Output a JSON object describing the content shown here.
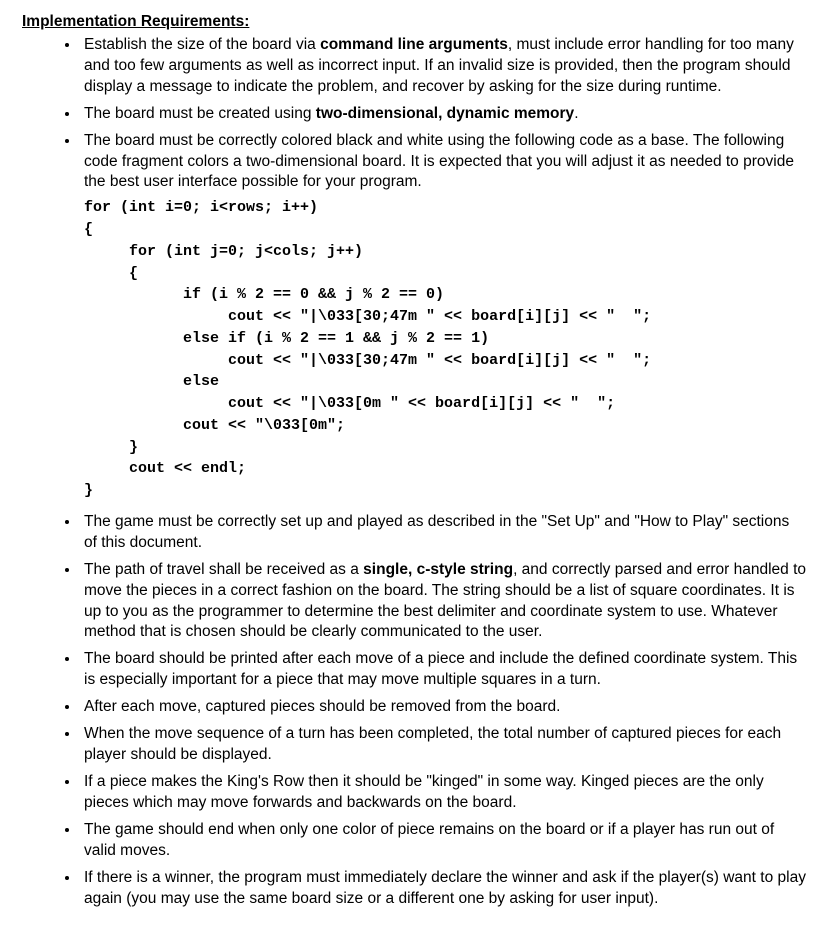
{
  "heading": "Implementation Requirements:",
  "bullets": {
    "b1a": "Establish the size of the board via ",
    "b1b": "command line arguments",
    "b1c": ", must include error handling for too many and too few arguments as well as incorrect input. If an invalid size is provided, then the program should display a message to indicate the problem, and recover by asking for the size during runtime.",
    "b2a": "The board must be created using ",
    "b2b": "two-dimensional, dynamic memory",
    "b2c": ".",
    "b3": "The board must be correctly colored black and white using the following code as a base. The following code fragment colors a two-dimensional board. It is expected that you will adjust it as needed to provide the best user interface possible for your program.",
    "b4": "The game must be correctly set up and played as described in the \"Set Up\" and \"How to Play\" sections of this document.",
    "b5a": "The path of travel shall be received as a ",
    "b5b": "single, c-style string",
    "b5c": ", and correctly parsed and error handled to move the pieces in a correct fashion on the board. The string should be a list of square coordinates. It is up to you as the programmer to determine the best delimiter and coordinate system to use. Whatever method that is chosen should be clearly communicated to the user.",
    "b6": "The board should be printed after each move of a piece and include the defined coordinate system. This is especially important for a piece that may move multiple squares in a turn.",
    "b7": "After each move, captured pieces should be removed from the board.",
    "b8": "When the move sequence of a turn has been completed, the total number of captured pieces for each player should be displayed.",
    "b9": "If a piece makes the King's Row then it should be \"kinged\" in some way. Kinged pieces are the only pieces which may move forwards and backwards on the board.",
    "b10": "The game should end when only one color of piece remains on the board or if a player has run out of valid moves.",
    "b11": "If there is a winner, the program must immediately declare the winner and ask if the player(s) want to play again (you may use the same board size or a different one by asking for user input)."
  },
  "code": "for (int i=0; i<rows; i++)\n{\n     for (int j=0; j<cols; j++)\n     {\n           if (i % 2 == 0 && j % 2 == 0)\n                cout << \"|\\033[30;47m \" << board[i][j] << \"  \";\n           else if (i % 2 == 1 && j % 2 == 1)\n                cout << \"|\\033[30;47m \" << board[i][j] << \"  \";\n           else\n                cout << \"|\\033[0m \" << board[i][j] << \"  \";\n           cout << \"\\033[0m\";\n     }\n     cout << endl;\n}"
}
